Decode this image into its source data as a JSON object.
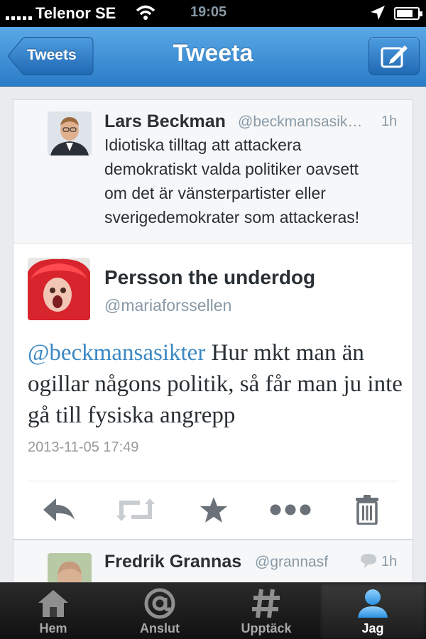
{
  "status_bar": {
    "carrier": "Telenor SE",
    "time": "19:05",
    "battery_level": 0.8
  },
  "nav": {
    "back_label": "Tweets",
    "title": "Tweeta",
    "compose_icon": "compose-icon"
  },
  "prev_tweet": {
    "name": "Lars Beckman",
    "handle": "@beckmansasik…",
    "time": "1h",
    "lines": [
      "Idiotiska tilltag att attackera",
      "demokratiskt valda politiker oavsett",
      "om det är vänsterpartister eller",
      "sverigedemokrater som attackeras!"
    ]
  },
  "main_tweet": {
    "name": "Persson the underdog",
    "handle": "@mariaforssellen",
    "mention": "@beckmansasikter",
    "text_rest": " Hur mkt man än ogillar någons politik, så får man ju inte gå till fysiska angrepp",
    "date": "2013-11-05 17:49",
    "actions": [
      "reply-icon",
      "retweet-icon",
      "favorite-icon",
      "more-icon",
      "delete-icon"
    ]
  },
  "next_tweet": {
    "name": "Fredrik Grannas",
    "handle": "@grannasf",
    "time": "1h"
  },
  "tabs": [
    {
      "label": "Hem",
      "icon": "home-icon"
    },
    {
      "label": "Anslut",
      "icon": "at-icon"
    },
    {
      "label": "Upptäck",
      "icon": "hash-icon"
    },
    {
      "label": "Jag",
      "icon": "profile-icon",
      "active": true
    }
  ],
  "colors": {
    "nav_blue": "#2a7cc8",
    "mention_blue": "#3b88c3",
    "muted_gray": "#8899a6"
  }
}
